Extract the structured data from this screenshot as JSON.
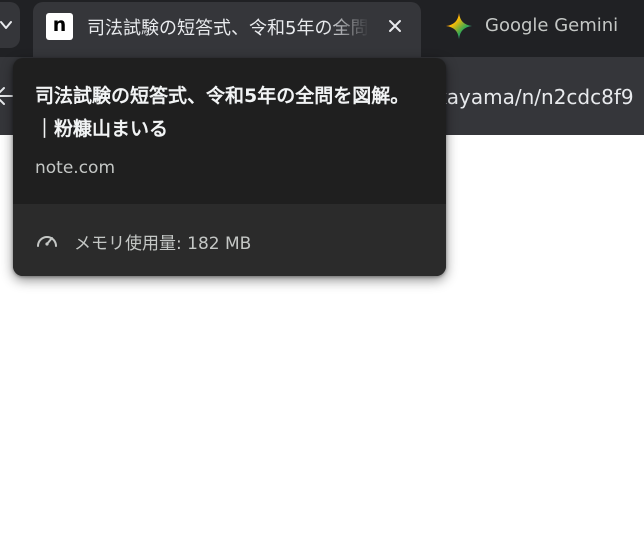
{
  "browser": {
    "active_tab": {
      "favicon_letter": "n",
      "title": "司法試験の短答式、令和5年の全問を図解。｜粉糠山まいる"
    },
    "inactive_tab": {
      "title": "Google Gemini"
    },
    "address_bar": {
      "url_visible": "ikayama/n/n2cdc8f9"
    }
  },
  "hover_card": {
    "title": "司法試験の短答式、令和5年の全問を図解。｜粉糠山まいる",
    "domain": "note.com",
    "memory_usage": "メモリ使用量: 182 MB"
  },
  "colors": {
    "tabstrip_bg": "#202124",
    "active_tab_bg": "#35363a",
    "hovercard_bg": "#1f1f1f",
    "hovercard_footer_bg": "#2b2b2b",
    "text_primary": "#f1f3f4",
    "text_secondary": "#c4c7c5"
  },
  "icons": {
    "tab_search": "chevron-down-icon",
    "tab_favicon": "note-favicon-icon",
    "close": "close-icon",
    "gemini": "gemini-sparkle-icon",
    "back": "back-arrow-icon",
    "memory": "gauge-icon"
  }
}
